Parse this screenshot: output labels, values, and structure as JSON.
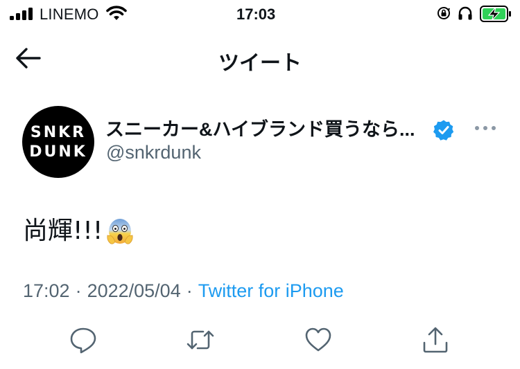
{
  "status_bar": {
    "carrier": "LINEMO",
    "time": "17:03"
  },
  "header": {
    "title": "ツイート"
  },
  "tweet": {
    "avatar_text_line1": "SNKR",
    "avatar_text_line2": "DUNK",
    "display_name": "スニーカー&ハイブランド買うなら...",
    "handle": "@snkrdunk",
    "text": "尚輝!!!",
    "time": "17:02",
    "date": "2022/05/04",
    "separator": "·",
    "source": "Twitter for iPhone"
  },
  "colors": {
    "accent": "#1d9bf0",
    "text": "#0f1419",
    "secondary": "#536471",
    "battery_charge": "#30d158"
  },
  "icons": {
    "back": "arrow-left-icon",
    "verified": "verified-badge-icon",
    "more": "more-dots-icon",
    "emoji": "face-screaming-in-fear-emoji",
    "actions": [
      "reply-icon",
      "retweet-icon",
      "like-icon",
      "share-icon"
    ]
  }
}
